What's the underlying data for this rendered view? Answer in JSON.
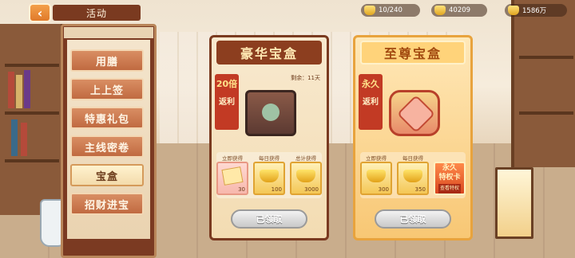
{
  "header": {
    "back_icon": "chevron-left-icon",
    "title": "活动"
  },
  "resources": [
    {
      "icon": "gold-chest-icon",
      "value": "10/240"
    },
    {
      "icon": "gold-ingot-icon",
      "value": "40209"
    },
    {
      "icon": "coin-pile-icon",
      "value": "1586万"
    }
  ],
  "menu": {
    "items": [
      {
        "label": "用膳",
        "active": false
      },
      {
        "label": "上上签",
        "active": false
      },
      {
        "label": "特惠礼包",
        "active": false
      },
      {
        "label": "主线密卷",
        "active": false
      },
      {
        "label": "宝盒",
        "active": true
      },
      {
        "label": "招财进宝",
        "active": false
      }
    ]
  },
  "cards": [
    {
      "title": "豪华宝盒",
      "tag_big": "20倍",
      "tag_text": "返利",
      "remaining": "剩余：11天",
      "reward_labels": [
        "立即获得",
        "每日获得",
        "总计获得"
      ],
      "rewards": [
        {
          "icon": "coupon-icon",
          "amount": "30"
        },
        {
          "icon": "gold-ingot-icon",
          "amount": "100"
        },
        {
          "icon": "gold-ingot-icon",
          "amount": "3000"
        }
      ],
      "button": "已领取"
    },
    {
      "title": "至尊宝盒",
      "tag_big": "永久",
      "tag_text": "返利",
      "reward_labels": [
        "立即获得",
        "每日获得"
      ],
      "rewards": [
        {
          "icon": "gold-ingot-icon",
          "amount": "300"
        },
        {
          "icon": "gold-ingot-icon",
          "amount": "350"
        }
      ],
      "privilege": {
        "line1": "永久",
        "line2": "特权卡",
        "sub": "查看特权"
      },
      "button": "已领取"
    }
  ]
}
